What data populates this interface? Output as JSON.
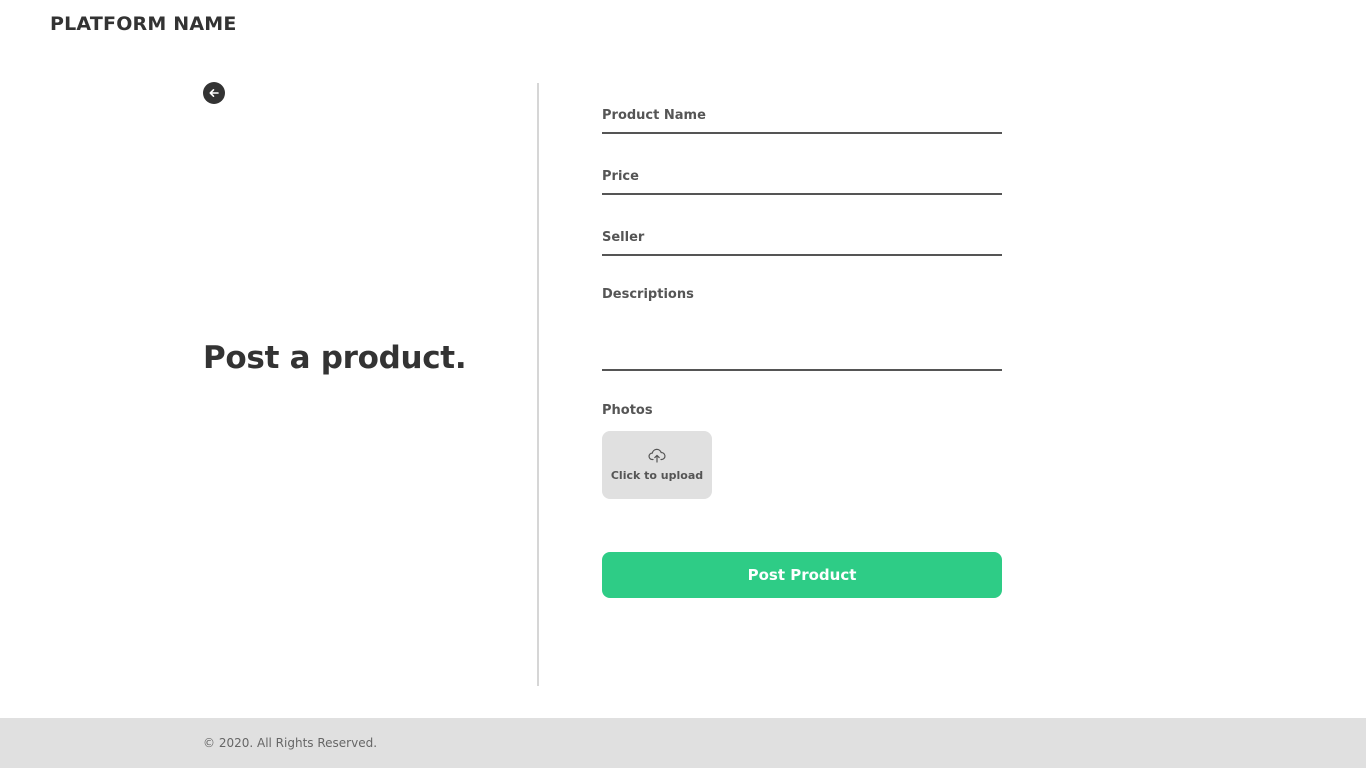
{
  "header": {
    "brand": "PLATFORM NAME"
  },
  "left": {
    "back_icon": "arrow-left-icon",
    "headline": "Post a product."
  },
  "form": {
    "product_name_placeholder": "Product Name",
    "price_placeholder": "Price",
    "seller_placeholder": "Seller",
    "descriptions_placeholder": "Descriptions",
    "photos_label": "Photos",
    "upload_icon": "cloud-upload-icon",
    "upload_text": "Click to upload",
    "submit_label": "Post Product"
  },
  "footer": {
    "copyright": "© 2020. All Rights Reserved."
  },
  "colors": {
    "accent": "#2ecc86",
    "text": "#333333",
    "muted": "#555555",
    "footer_bg": "#e0e0e0"
  }
}
